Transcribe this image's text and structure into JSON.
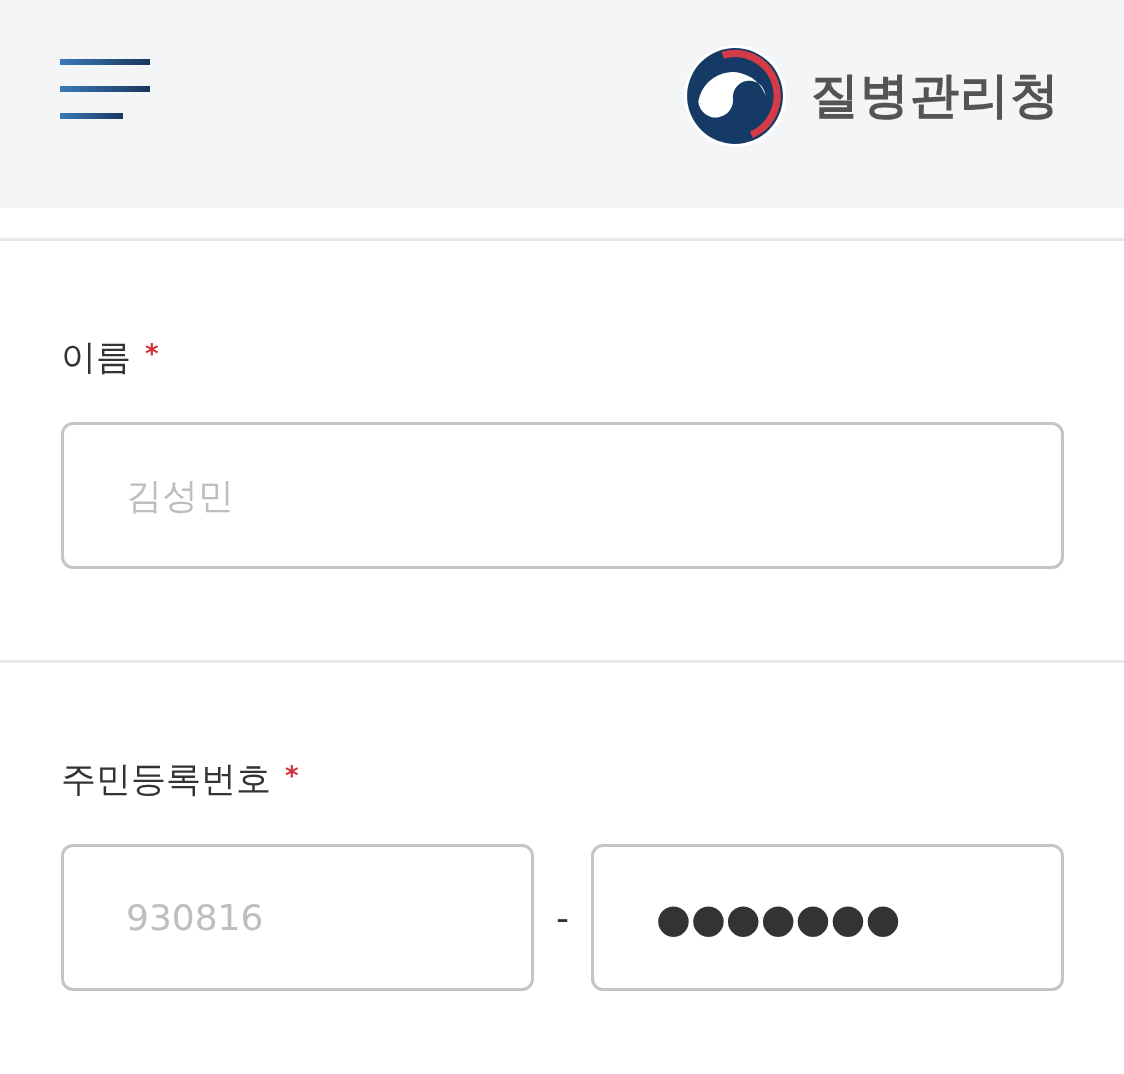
{
  "header": {
    "logo_text": "질병관리청"
  },
  "form": {
    "fields": [
      {
        "kind": "single",
        "label": "이름",
        "required_mark": "*",
        "inputs": [
          {
            "placeholder": "김성민"
          }
        ]
      },
      {
        "kind": "split",
        "label": "주민등록번호",
        "required_mark": "*",
        "separator": "-",
        "inputs": [
          {
            "placeholder": "930816"
          },
          {
            "value": "●●●●●●●"
          }
        ]
      }
    ]
  }
}
